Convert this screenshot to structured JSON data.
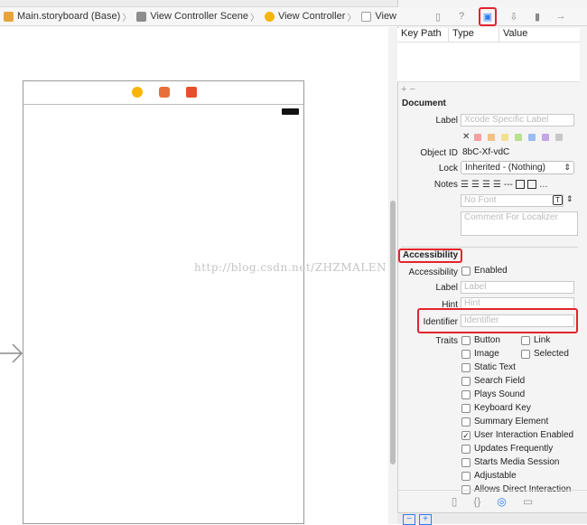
{
  "breadcrumb": [
    {
      "label": "Main.storyboard (Base)",
      "icon": "storyboard-file-icon",
      "color": "#e7a43b"
    },
    {
      "label": "View Controller Scene",
      "icon": "scene-icon",
      "color": "#8d8d8d"
    },
    {
      "label": "View Controller",
      "icon": "view-controller-icon",
      "color": "#f5b50a"
    },
    {
      "label": "View",
      "icon": "view-icon",
      "color": "#9d9d9d"
    }
  ],
  "inspector_tabs": [
    "file-inspector-icon",
    "quick-help-icon",
    "identity-inspector-icon",
    "attributes-inspector-icon",
    "size-inspector-icon",
    "connections-inspector-icon"
  ],
  "key_path_table": {
    "headers": [
      "Key Path",
      "Type",
      "Value"
    ],
    "add_remove": "+ −"
  },
  "document": {
    "section_title": "Document",
    "label_label": "Label",
    "label_placeholder": "Xcode Specific Label",
    "clear_glyph": "✕",
    "swatches": [
      "#f2a0a0",
      "#f4c088",
      "#f3e08e",
      "#b8e08e",
      "#9bbcf0",
      "#c3a6e6",
      "#c8c8c8"
    ],
    "object_id_label": "Object ID",
    "object_id_value": "8bC-Xf-vdC",
    "lock_label": "Lock",
    "lock_value": "Inherited - (Nothing)",
    "notes_label": "Notes",
    "font_placeholder": "No Font",
    "comment_placeholder": "Comment For Localizer"
  },
  "accessibility": {
    "section_title": "Accessibility",
    "accessibility_label": "Accessibility",
    "enabled_label": "Enabled",
    "label_label": "Label",
    "label_placeholder": "Label",
    "hint_label": "Hint",
    "hint_placeholder": "Hint",
    "identifier_label": "Identifier",
    "identifier_placeholder": "Identifier",
    "traits_label": "Traits",
    "traits_left": [
      {
        "label": "Button",
        "checked": false
      },
      {
        "label": "Image",
        "checked": false
      },
      {
        "label": "Static Text",
        "checked": false
      },
      {
        "label": "Search Field",
        "checked": false
      },
      {
        "label": "Plays Sound",
        "checked": false
      },
      {
        "label": "Keyboard Key",
        "checked": false
      },
      {
        "label": "Summary Element",
        "checked": false
      },
      {
        "label": "User Interaction Enabled",
        "checked": true
      },
      {
        "label": "Updates Frequently",
        "checked": false
      },
      {
        "label": "Starts Media Session",
        "checked": false
      },
      {
        "label": "Adjustable",
        "checked": false
      },
      {
        "label": "Allows Direct Interaction",
        "checked": false
      }
    ],
    "traits_right": [
      {
        "label": "Link",
        "checked": false
      },
      {
        "label": "Selected",
        "checked": false
      }
    ]
  },
  "watermark": "http://blog.csdn.net/ZHZMALEN",
  "highlight_color": "#e3232d"
}
